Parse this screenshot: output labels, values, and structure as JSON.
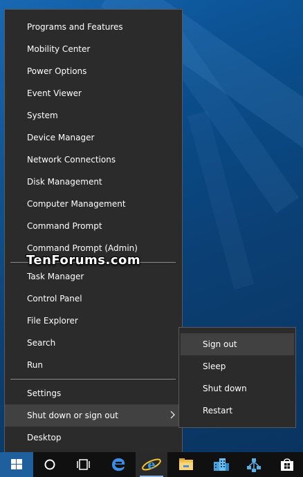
{
  "watermark": "TenForums.com",
  "winx_menu": {
    "group1": [
      "Programs and Features",
      "Mobility Center",
      "Power Options",
      "Event Viewer",
      "System",
      "Device Manager",
      "Network Connections",
      "Disk Management",
      "Computer Management",
      "Command Prompt",
      "Command Prompt (Admin)"
    ],
    "group2": [
      "Task Manager",
      "Control Panel",
      "File Explorer",
      "Search",
      "Run"
    ],
    "group3": [
      "Settings",
      "Shut down or sign out",
      "Desktop"
    ],
    "highlighted": "Shut down or sign out"
  },
  "submenu": {
    "items": [
      "Sign out",
      "Sleep",
      "Shut down",
      "Restart"
    ],
    "highlighted": "Sign out"
  },
  "taskbar": {
    "icons": [
      "windows-start-icon",
      "cortana-icon",
      "task-view-icon",
      "edge-icon",
      "internet-explorer-icon",
      "file-explorer-icon",
      "buildings-icon",
      "network-icon",
      "store-icon"
    ]
  },
  "colors": {
    "menu_bg": "#2b2b2b",
    "menu_highlight": "#414141",
    "taskbar_bg": "#101010",
    "start_bg": "#1f5f9e",
    "accent": "#1e90ff"
  }
}
